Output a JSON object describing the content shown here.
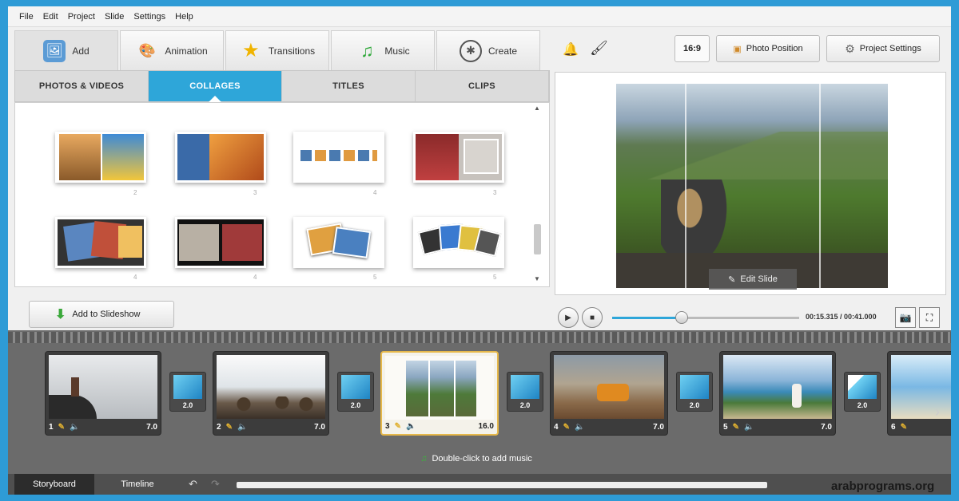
{
  "menu": [
    "File",
    "Edit",
    "Project",
    "Slide",
    "Settings",
    "Help"
  ],
  "main_tabs": [
    {
      "label": "Add",
      "icon": "add-media-icon"
    },
    {
      "label": "Animation",
      "icon": "palette-icon"
    },
    {
      "label": "Transitions",
      "icon": "star-icon"
    },
    {
      "label": "Music",
      "icon": "music-note-icon"
    },
    {
      "label": "Create",
      "icon": "film-reel-icon"
    }
  ],
  "sub_tabs": [
    "PHOTOS & VIDEOS",
    "COLLAGES",
    "TITLES",
    "CLIPS"
  ],
  "active_sub_tab": "COLLAGES",
  "collage_counts": [
    "2",
    "3",
    "4",
    "3",
    "4",
    "4",
    "5",
    "5"
  ],
  "add_button": "Add to Slideshow",
  "toolbar": {
    "ratio": "16:9",
    "photo_position": "Photo Position",
    "project_settings": "Project Settings"
  },
  "preview": {
    "edit_slide": "Edit Slide"
  },
  "player": {
    "time": "00:15.315 / 00:41.000",
    "progress": 0.37
  },
  "slides": [
    {
      "num": "1",
      "duration": "7.0"
    },
    {
      "num": "2",
      "duration": "7.0"
    },
    {
      "num": "3",
      "duration": "16.0"
    },
    {
      "num": "4",
      "duration": "7.0"
    },
    {
      "num": "5",
      "duration": "7.0"
    },
    {
      "num": "6",
      "duration": ""
    }
  ],
  "transitions": [
    "2.0",
    "2.0",
    "2.0",
    "2.0",
    "2.0"
  ],
  "music_hint": "Double-click to add music",
  "bottom_tabs": [
    "Storyboard",
    "Timeline"
  ],
  "watermark": "arabprograms.org",
  "colors": {
    "accent": "#2ea6d9",
    "selected_border": "#e6b84a",
    "frame": "#2e9bd6"
  }
}
